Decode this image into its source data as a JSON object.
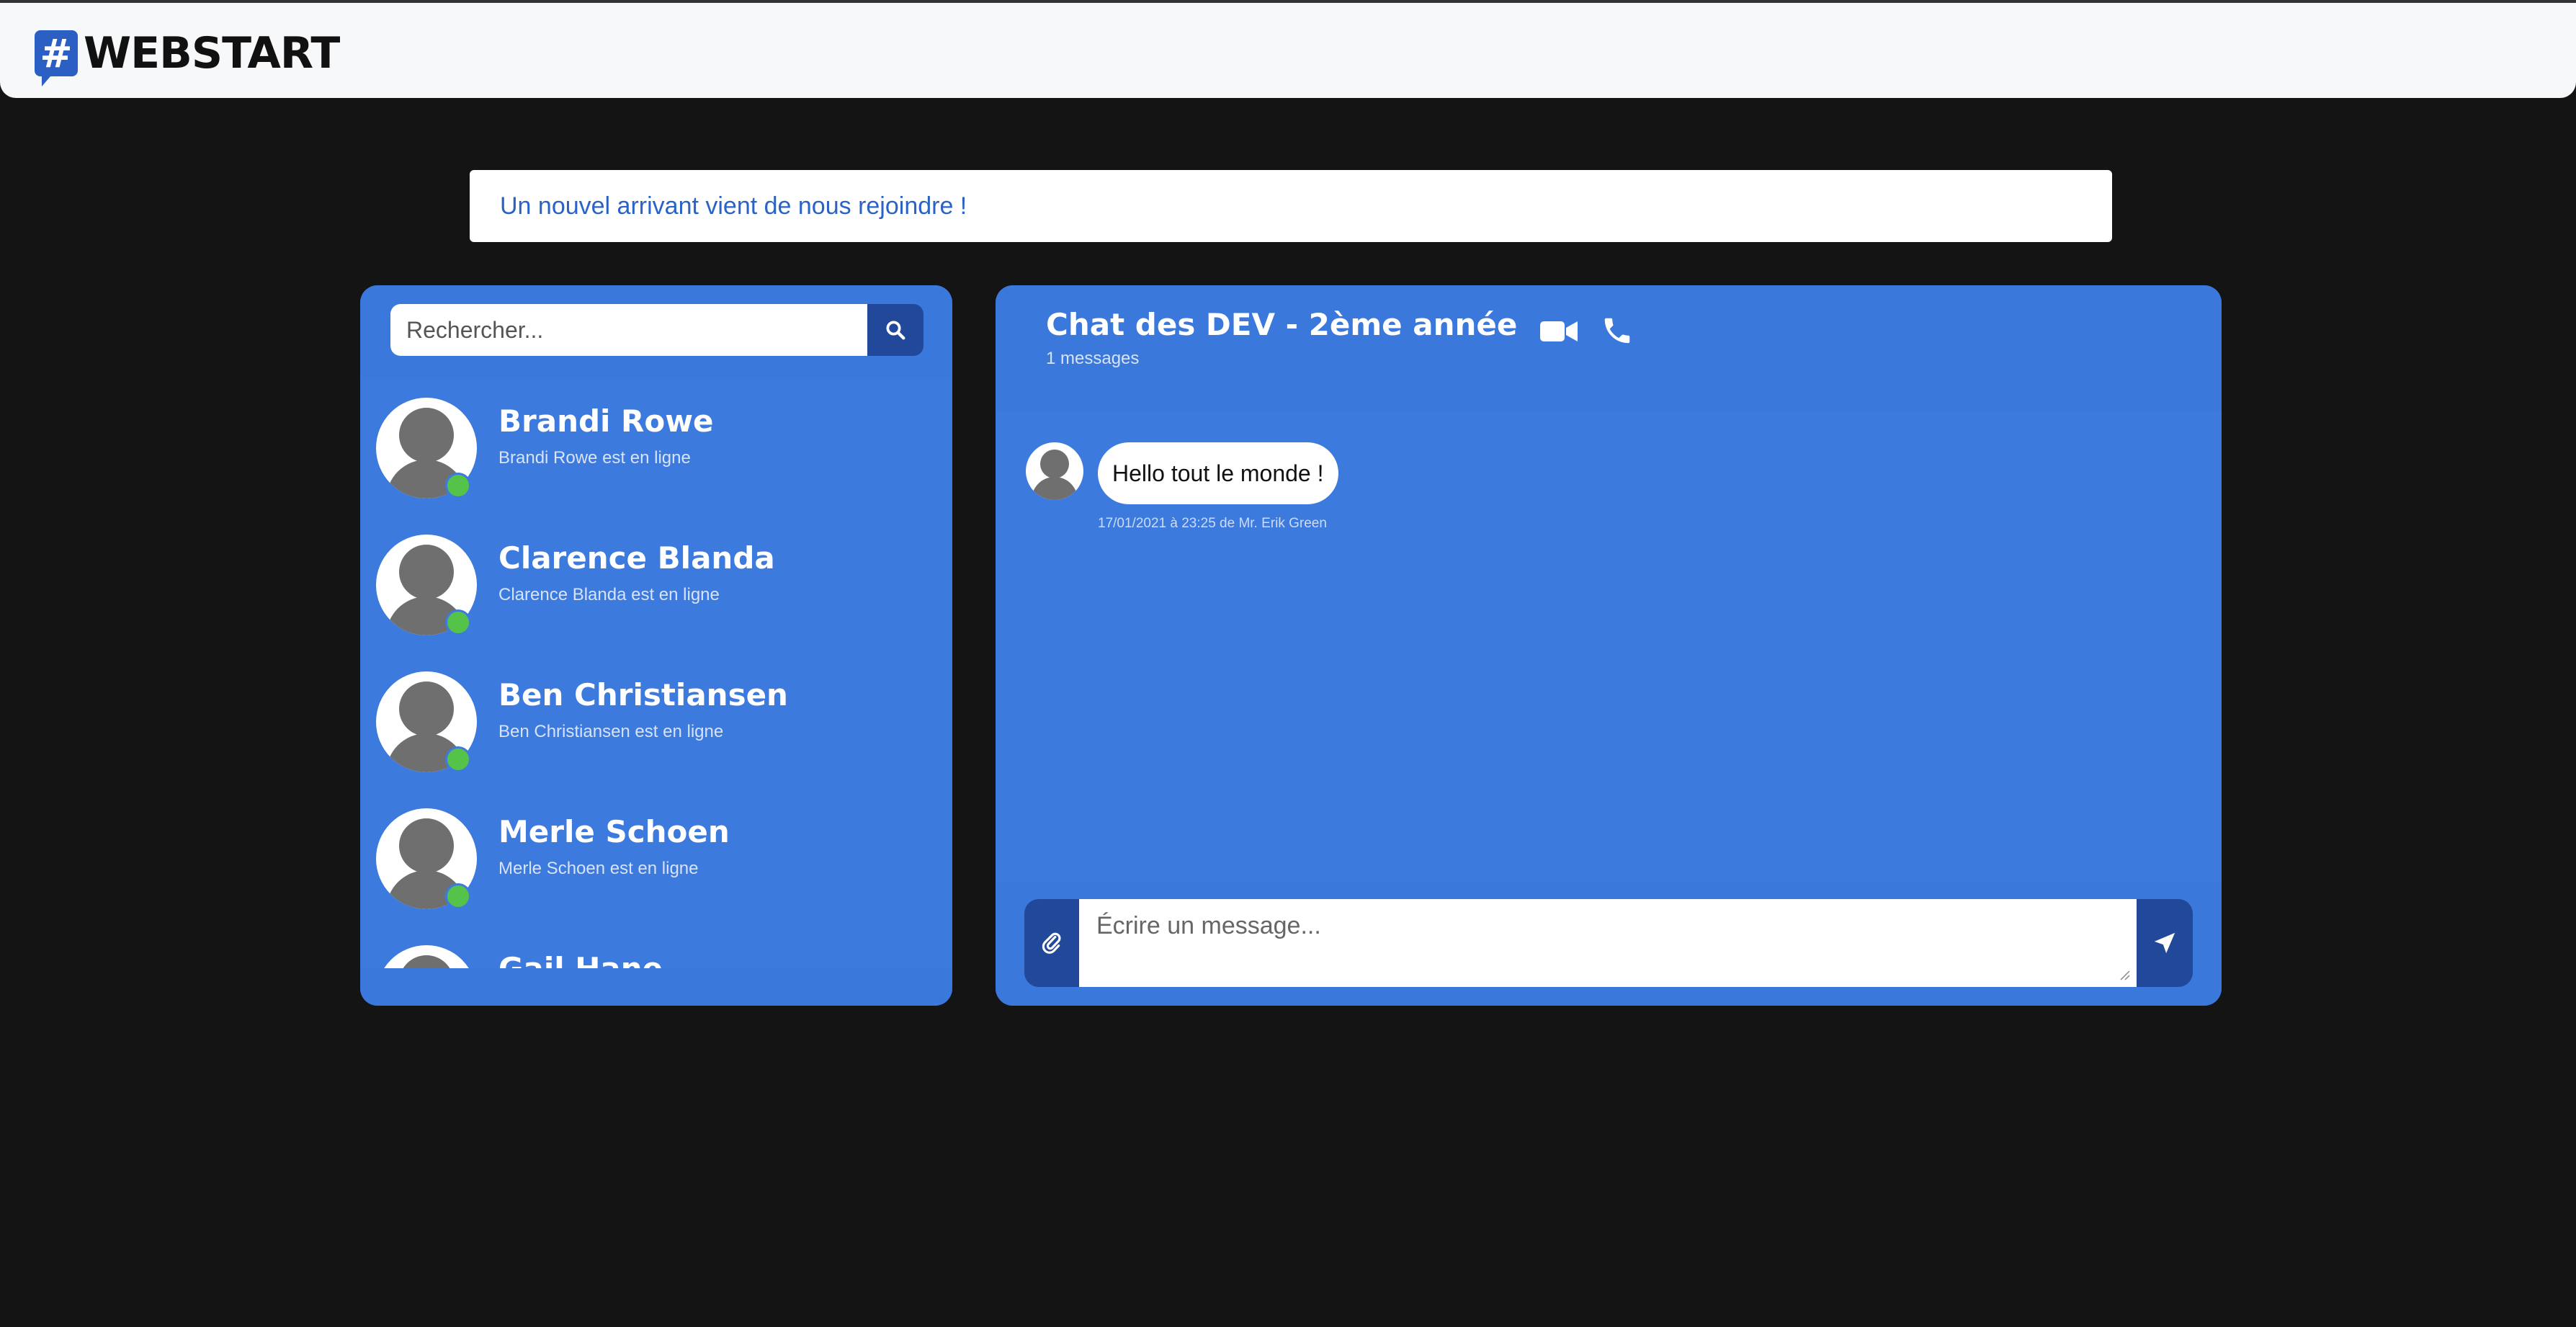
{
  "brand": {
    "logo_symbol": "#",
    "name": "WEBSTART"
  },
  "notice": {
    "text": "Un nouvel arrivant vient de nous rejoindre !"
  },
  "search": {
    "placeholder": "Rechercher...",
    "icon": "search-icon"
  },
  "users": [
    {
      "name": "Brandi Rowe",
      "status": "Brandi Rowe est en ligne",
      "online": true
    },
    {
      "name": "Clarence Blanda",
      "status": "Clarence Blanda est en ligne",
      "online": true
    },
    {
      "name": "Ben Christiansen",
      "status": "Ben Christiansen est en ligne",
      "online": true
    },
    {
      "name": "Merle Schoen",
      "status": "Merle Schoen est en ligne",
      "online": true
    },
    {
      "name": "Gail Hane",
      "status": "",
      "online": true
    }
  ],
  "chat": {
    "title": "Chat des DEV - 2ème année",
    "count": "1 messages",
    "icons": [
      "video-camera-icon",
      "phone-icon"
    ],
    "messages": [
      {
        "text": "Hello tout le monde !",
        "meta": "17/01/2021 à 23:25 de Mr. Erik Green"
      }
    ]
  },
  "composer": {
    "placeholder": "Écrire un message...",
    "attach_icon": "paperclip-icon",
    "send_icon": "send-arrow-icon"
  },
  "colors": {
    "panel": "#3a78db",
    "dark_button": "#22489a",
    "online": "#55c24a",
    "background": "#141414"
  }
}
